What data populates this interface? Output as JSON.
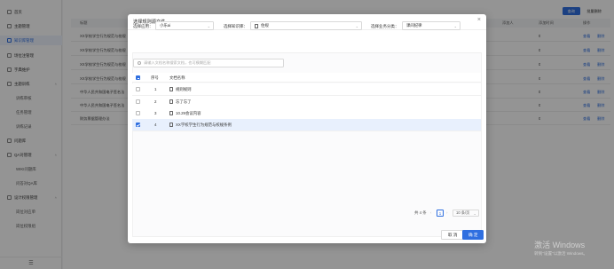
{
  "sidebar": {
    "items": [
      {
        "label": "首页",
        "type": "top"
      },
      {
        "label": "主题管理",
        "type": "top"
      },
      {
        "label": "知识库管理",
        "type": "top",
        "active": true
      },
      {
        "label": "场位注管理",
        "type": "top"
      },
      {
        "label": "字典维护",
        "type": "top"
      },
      {
        "label": "主题训练",
        "type": "group"
      },
      {
        "label": "训练审核",
        "type": "sub"
      },
      {
        "label": "任务管理",
        "type": "sub"
      },
      {
        "label": "训练记录",
        "type": "sub"
      },
      {
        "label": "问题库",
        "type": "top"
      },
      {
        "label": "QA对管理",
        "type": "group"
      },
      {
        "label": "WIKI问题库",
        "type": "sub"
      },
      {
        "label": "问答对QA库",
        "type": "sub"
      },
      {
        "label": "设计权限管理",
        "type": "group"
      },
      {
        "label": "岗位对应单",
        "type": "sub"
      },
      {
        "label": "岗位权限组",
        "type": "sub"
      }
    ],
    "collapse_icon": "menu-icon"
  },
  "background": {
    "query_button": "查询",
    "batch_button": "批量删除",
    "headers": [
      "标题",
      "添加人",
      "添加时间",
      "操作"
    ],
    "rows": [
      {
        "title": "XX学校学生行为规范与校规",
        "count": "0",
        "ops": [
          "查看",
          "删除"
        ]
      },
      {
        "title": "XX学校学生行为规范与校规",
        "count": "0",
        "ops": [
          "查看",
          "删除"
        ]
      },
      {
        "title": "XX学校学生行为规范与校规",
        "count": "0",
        "ops": [
          "查看",
          "删除"
        ]
      },
      {
        "title": "XX学校学生行为规范与校规",
        "count": "0",
        "ops": [
          "查看",
          "删除"
        ]
      },
      {
        "title": "中华人民共和国电子签名法",
        "count": "0",
        "ops": [
          "查看",
          "删除"
        ]
      },
      {
        "title": "中华人民共和国电子签名法",
        "count": "0",
        "ops": [
          "查看",
          "删除"
        ]
      },
      {
        "title": "财务票据管理办法",
        "count": "0",
        "ops": [
          "查看",
          "删除"
        ]
      }
    ]
  },
  "dialog": {
    "title": "选择规则源文件",
    "filters": {
      "app_label": "选择应用：",
      "app_value": "小乐ai",
      "kb_label": "选择知识库：",
      "kb_value": "住规",
      "category_label": "选择业务分类：",
      "category_value": "课间纪律"
    },
    "search_placeholder": "请输入文档名称搜索文档，也可模糊匹配",
    "table": {
      "headers": {
        "index": "序号",
        "name": "文档名称"
      },
      "rows": [
        {
          "index": "1",
          "name": "规则规则",
          "checked": false
        },
        {
          "index": "2",
          "name": "忘了忘了",
          "checked": false
        },
        {
          "index": "3",
          "name": "10.29会议内容",
          "checked": false
        },
        {
          "index": "4",
          "name": "XX学校学生行为规范与校规条例",
          "checked": true
        }
      ]
    },
    "pagination": {
      "total": "共 4 条",
      "prev": "‹",
      "page": "1",
      "next": "›",
      "page_size": "10 条/页"
    },
    "cancel": "取 消",
    "confirm": "确 定"
  },
  "watermark": {
    "line1": "激活 Windows",
    "line2": "转到\"设置\"以激活 Windows。"
  },
  "colors": {
    "primary": "#2f6fe0",
    "mask": "rgba(0,0,0,0.42)"
  }
}
